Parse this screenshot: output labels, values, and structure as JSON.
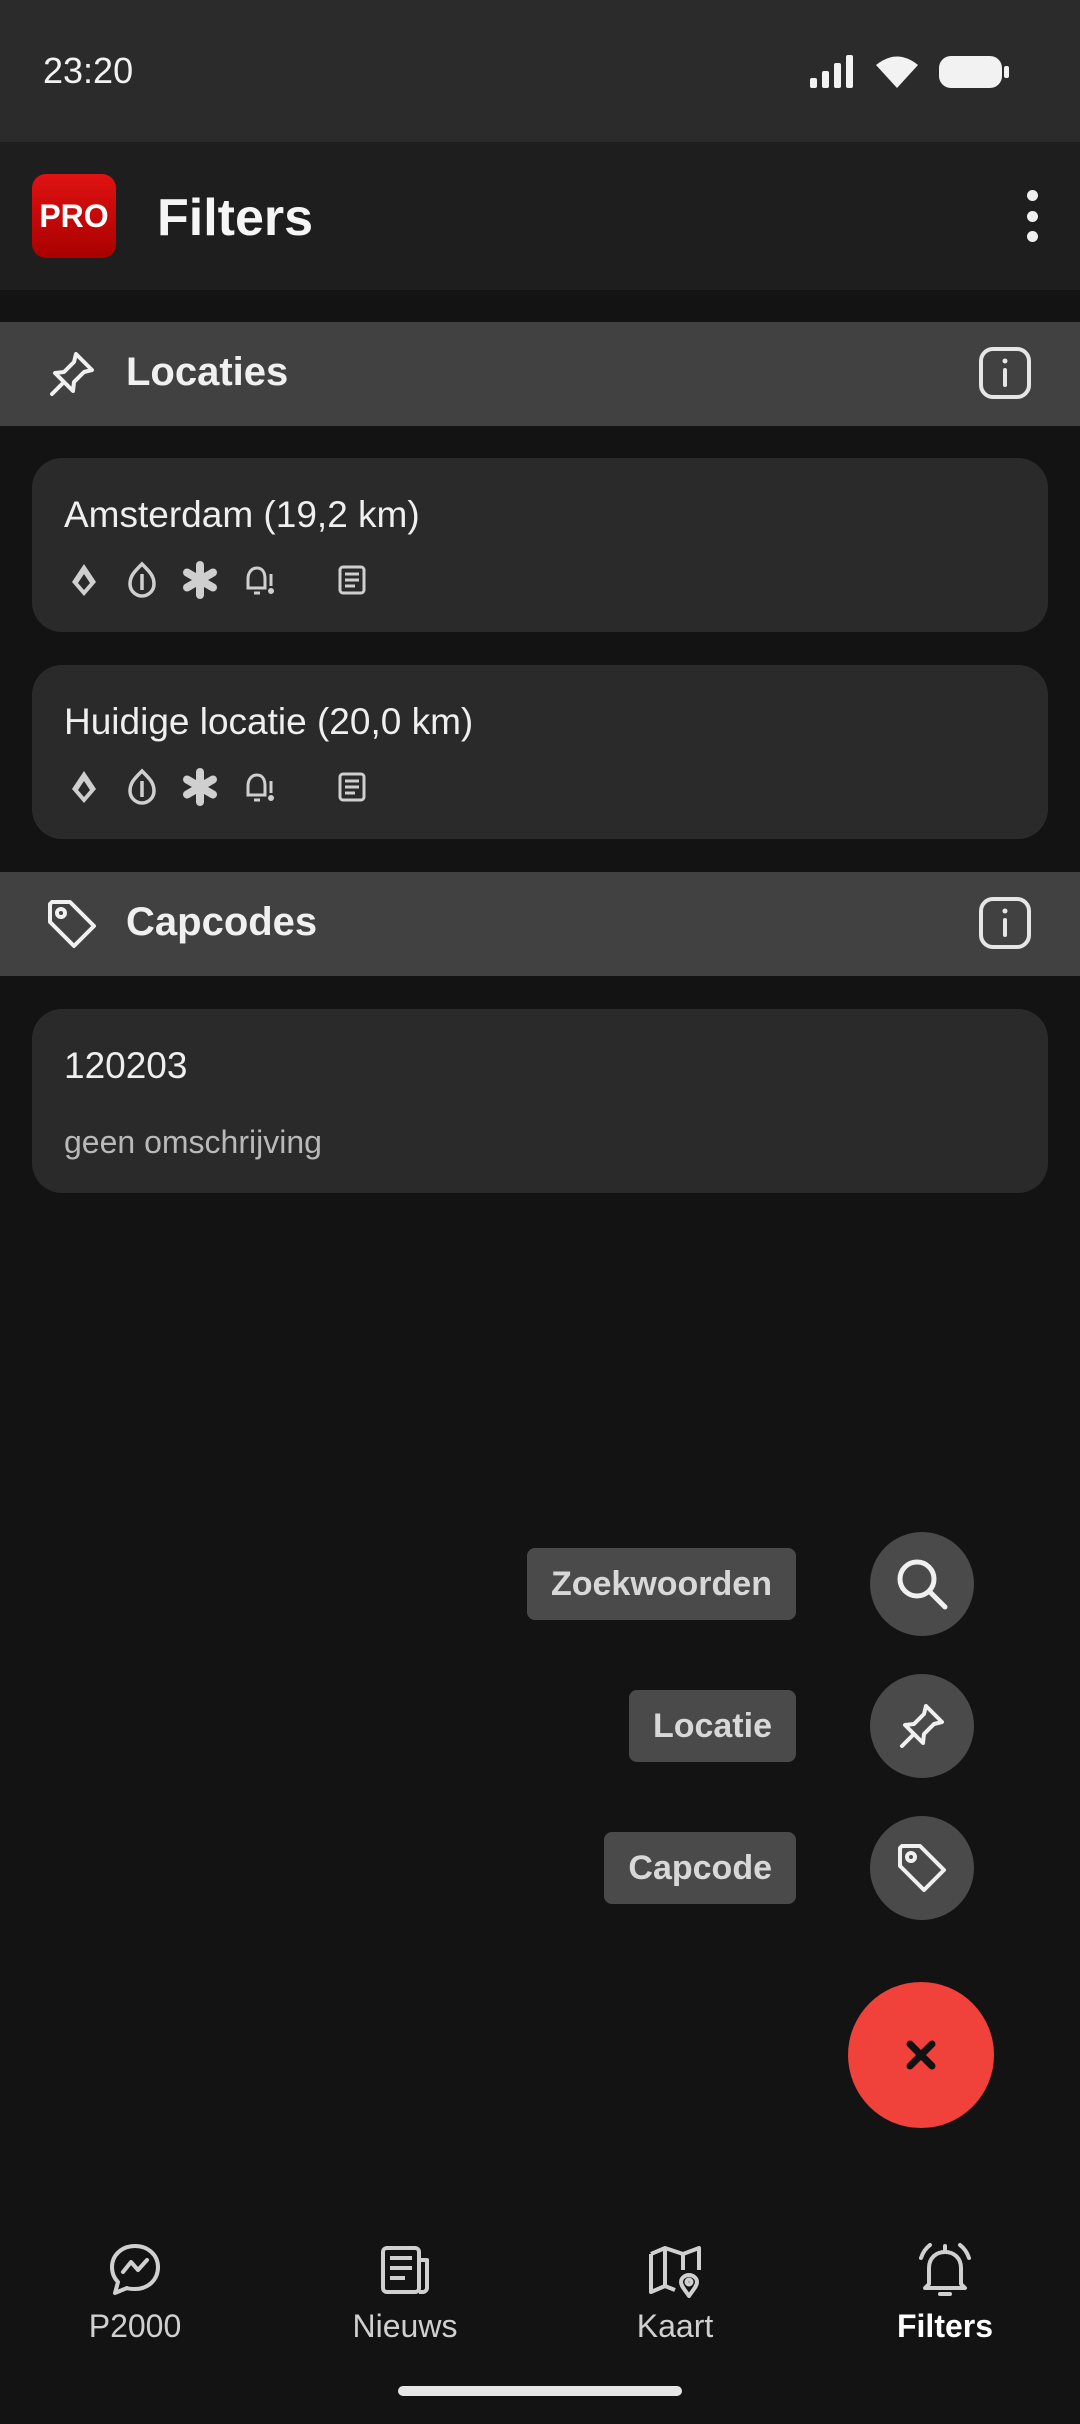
{
  "status": {
    "time": "23:20"
  },
  "appbar": {
    "logo_text": "PRO",
    "title": "Filters"
  },
  "locations_section": {
    "title": "Locaties",
    "items": [
      {
        "title": "Amsterdam (19,2 km)",
        "icons": [
          "fire-icon",
          "brandweer-icon",
          "ambulance-icon",
          "alert-bell-icon",
          "news-icon"
        ]
      },
      {
        "title": "Huidige locatie (20,0 km)",
        "icons": [
          "fire-icon",
          "brandweer-icon",
          "ambulance-icon",
          "alert-bell-icon",
          "news-icon"
        ]
      }
    ]
  },
  "capcodes_section": {
    "title": "Capcodes",
    "items": [
      {
        "code": "120203",
        "description": "geen omschrijving"
      }
    ]
  },
  "speed_dial": {
    "actions": [
      {
        "label": "Zoekwoorden",
        "icon": "search-icon"
      },
      {
        "label": "Locatie",
        "icon": "pin-icon"
      },
      {
        "label": "Capcode",
        "icon": "tag-icon"
      }
    ],
    "close_icon": "close-icon"
  },
  "bottom_nav": {
    "items": [
      {
        "label": "P2000",
        "icon": "chat-icon",
        "active": false
      },
      {
        "label": "Nieuws",
        "icon": "newspaper-icon",
        "active": false
      },
      {
        "label": "Kaart",
        "icon": "map-icon",
        "active": false
      },
      {
        "label": "Filters",
        "icon": "bell-icon",
        "active": true
      }
    ]
  },
  "colors": {
    "accent": "#f0413a",
    "logo_red": "#d40d0d",
    "background": "#131313",
    "card": "#2a2a2b",
    "section_header": "#414142"
  }
}
